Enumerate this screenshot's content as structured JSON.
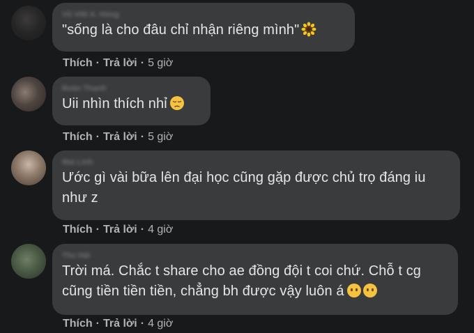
{
  "comments": [
    {
      "author": "Võ Viết A. Hùng",
      "text": "\"sống là cho đâu chỉ nhận riêng mình\"",
      "emoji": "sunflower",
      "like_label": "Thích",
      "reply_label": "Trả lời",
      "time": "5 giờ"
    },
    {
      "author": "Đoàn Thạnh",
      "text": "Uii nhìn thích nhỉ",
      "emoji": "pensive-face",
      "like_label": "Thích",
      "reply_label": "Trả lời",
      "time": "5 giờ"
    },
    {
      "author": "Mai Linh",
      "text": "Ước gì vài bữa lên đại học cũng gặp được chủ trọ đáng iu như z",
      "emoji": "",
      "like_label": "Thích",
      "reply_label": "Trả lời",
      "time": "4 giờ"
    },
    {
      "author": "Thu Hải",
      "text": "Trời má. Chắc t share cho ae đồng đội t coi chứ. Chỗ t cg cũng tiền tiền tiền, chẳng bh được vậy luôn á",
      "emoji": "face-without-mouth x2",
      "like_label": "Thích",
      "reply_label": "Trả lời",
      "time": "4 giờ"
    }
  ],
  "colors": {
    "background": "#18191a",
    "bubble": "#3a3b3c",
    "text": "#e4e6eb",
    "meta": "#b0b3b8"
  }
}
